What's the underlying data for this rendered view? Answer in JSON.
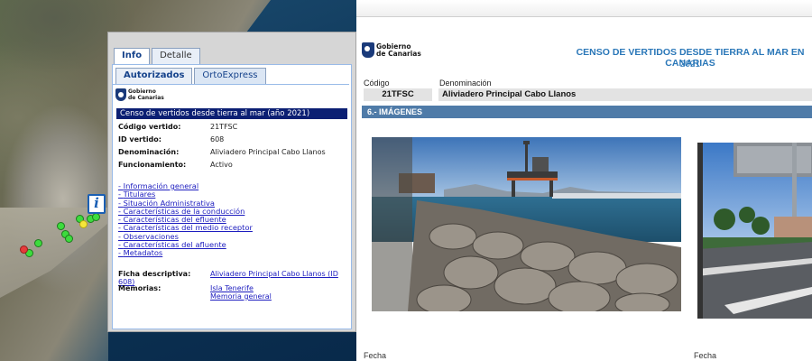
{
  "map": {
    "info_marker": "i"
  },
  "popup": {
    "tabs": [
      "Info",
      "Detalle"
    ],
    "subtabs": [
      "Autorizados",
      "OrtoExpress"
    ],
    "logo_text": [
      "Gobierno",
      "de Canarias"
    ],
    "header_bar": "Censo de vertidos desde tierra al mar (año 2021)",
    "fields": [
      {
        "label": "Código vertido:",
        "value": "21TFSC"
      },
      {
        "label": "ID vertido:",
        "value": "608"
      },
      {
        "label": "Denominación:",
        "value": "Aliviadero Principal Cabo Llanos"
      },
      {
        "label": "Funcionamiento:",
        "value": "Activo"
      }
    ],
    "links": [
      "Información general",
      "Titulares",
      "Situación Administrativa",
      "Características de la conducción",
      "Características del efluente",
      "Características del medio receptor",
      "Observaciones",
      "Características del afluente",
      "Metadatos"
    ],
    "ficha_label": "Ficha descriptiva:",
    "ficha_link": "Aliviadero Principal Cabo Llanos (ID 608)",
    "memorias_label": "Memorias:",
    "memorias_links": [
      "Isla Tenerife",
      "Memoria general"
    ]
  },
  "doc": {
    "logo_text": [
      "Gobierno",
      "de Canarias"
    ],
    "title": "CENSO DE VERTIDOS DESDE TIERRA AL MAR EN CANARIAS",
    "year": "2021",
    "codigo_label": "Código",
    "codigo_value": "21TFSC",
    "denominacion_label": "Denominación",
    "denominacion_value": "Aliviadero Principal Cabo Llanos",
    "section": "6.- IMÁGENES",
    "fecha_labels": [
      "Fecha",
      "Fecha"
    ]
  },
  "colors": {
    "popup_header": "#0b1f73",
    "section_bar": "#4f7ba8",
    "doc_title": "#2a77b8",
    "link": "#1d1dbf",
    "marker_green": "#3ddc3d",
    "marker_yellow": "#f5e63a",
    "marker_red": "#e63b3b"
  }
}
